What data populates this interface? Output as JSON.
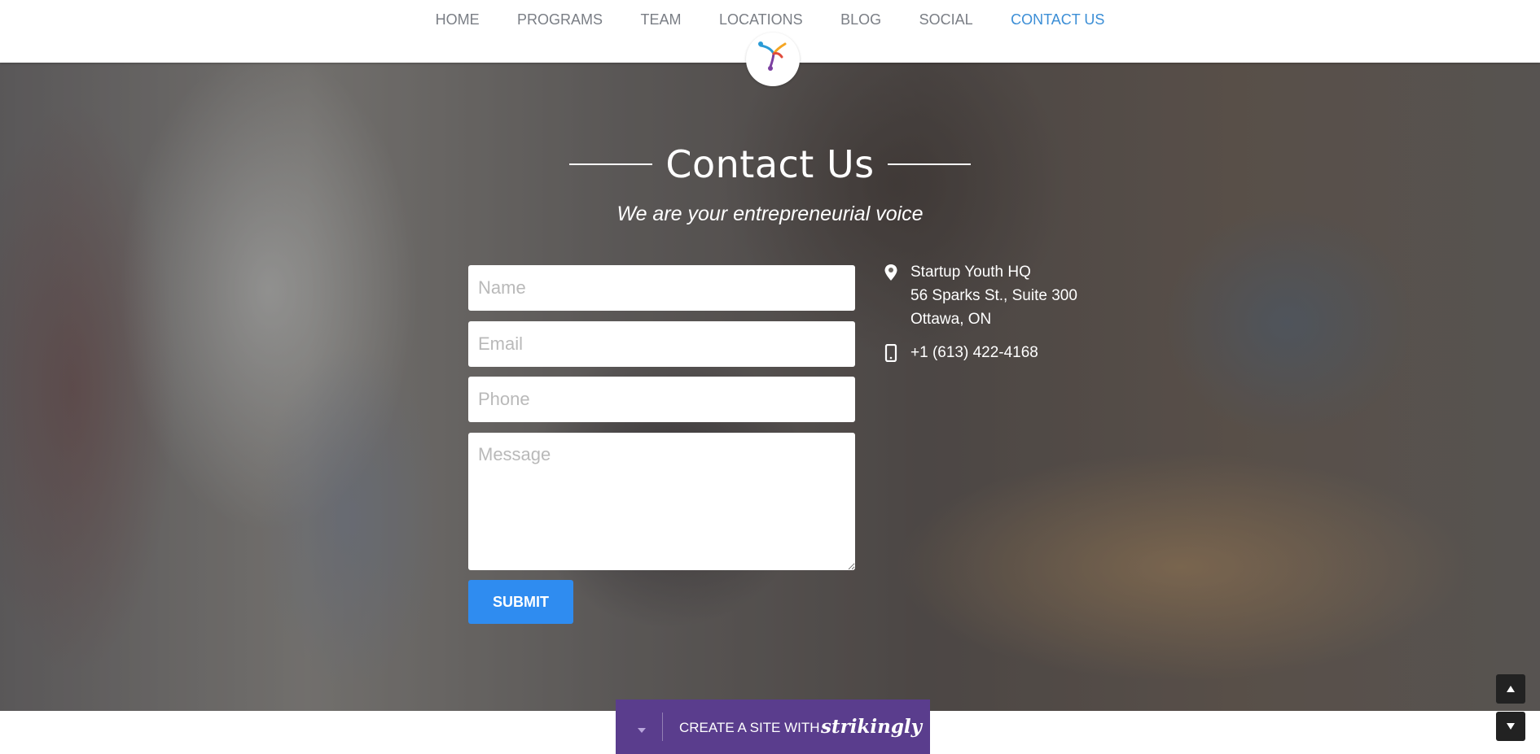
{
  "nav": {
    "items": [
      {
        "label": "HOME"
      },
      {
        "label": "PROGRAMS"
      },
      {
        "label": "TEAM"
      },
      {
        "label": "LOCATIONS"
      },
      {
        "label": "BLOG"
      },
      {
        "label": "SOCIAL"
      },
      {
        "label": "CONTACT US",
        "active": true
      }
    ],
    "active_color": "#3b8ed6"
  },
  "hero": {
    "title": "Contact Us",
    "subtitle": "We are your entrepreneurial voice"
  },
  "form": {
    "name_placeholder": "Name",
    "email_placeholder": "Email",
    "phone_placeholder": "Phone",
    "message_placeholder": "Message",
    "submit_label": "SUBMIT",
    "submit_color": "#2f8cf0"
  },
  "contact": {
    "address_icon": "map-pin-icon",
    "address_lines": [
      "Startup Youth HQ",
      "56 Sparks St., Suite 300",
      "Ottawa, ON"
    ],
    "phone_icon": "mobile-phone-icon",
    "phone": "+1 (613) 422-4168"
  },
  "banner": {
    "text": "CREATE A SITE WITH",
    "brand": "strikingly",
    "color": "#5a3d8d"
  }
}
